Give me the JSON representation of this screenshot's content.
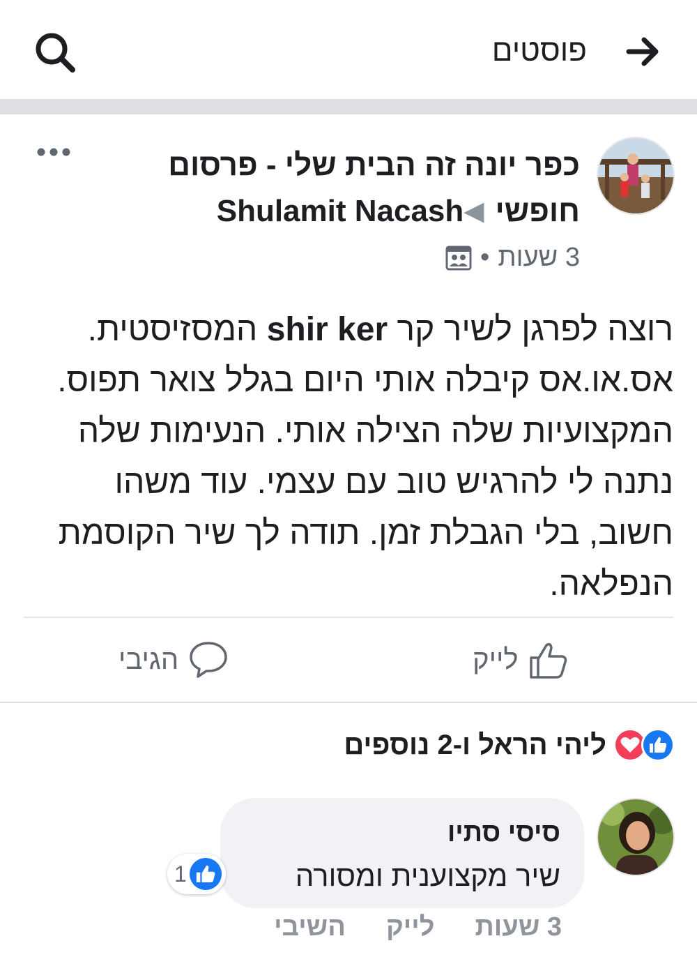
{
  "header": {
    "title": "פוסטים",
    "back_icon": "arrow-right-icon",
    "search_icon": "search-icon"
  },
  "post": {
    "group_name": "כפר יונה זה הבית שלי - פרסום חופשי",
    "author": "Shulamit Nacash",
    "time": "3 שעות",
    "dot": "•",
    "body_mention": "shir ker",
    "body_prefix": "רוצה לפרגן לשיר קר",
    "body_rest": "המסזיסטית. אס.או.אס קיבלה אותי היום בגלל צואר תפוס. המקצועיות שלה הצילה אותי. הנעימות שלה נתנה לי להרגיש טוב עם עצמי. עוד משהו חשוב, בלי הגבלת זמן. תודה לך שיר הקוסמת הנפלאה.",
    "actions": {
      "like": "לייק",
      "comment": "הגיבי"
    }
  },
  "reactions": {
    "summary": "ליהי הראל ו-2 נוספים",
    "icons": [
      "like-icon",
      "love-icon"
    ]
  },
  "comment": {
    "author": "סיסי סתיו",
    "text": "שיר מקצוענית ומסורה",
    "like_count": "1",
    "time": "3 שעות",
    "like": "לייק",
    "reply": "השיבי"
  },
  "colors": {
    "accent": "#1877f2",
    "love": "#f33e58",
    "muted": "#606770",
    "divider": "#dddfe2"
  }
}
